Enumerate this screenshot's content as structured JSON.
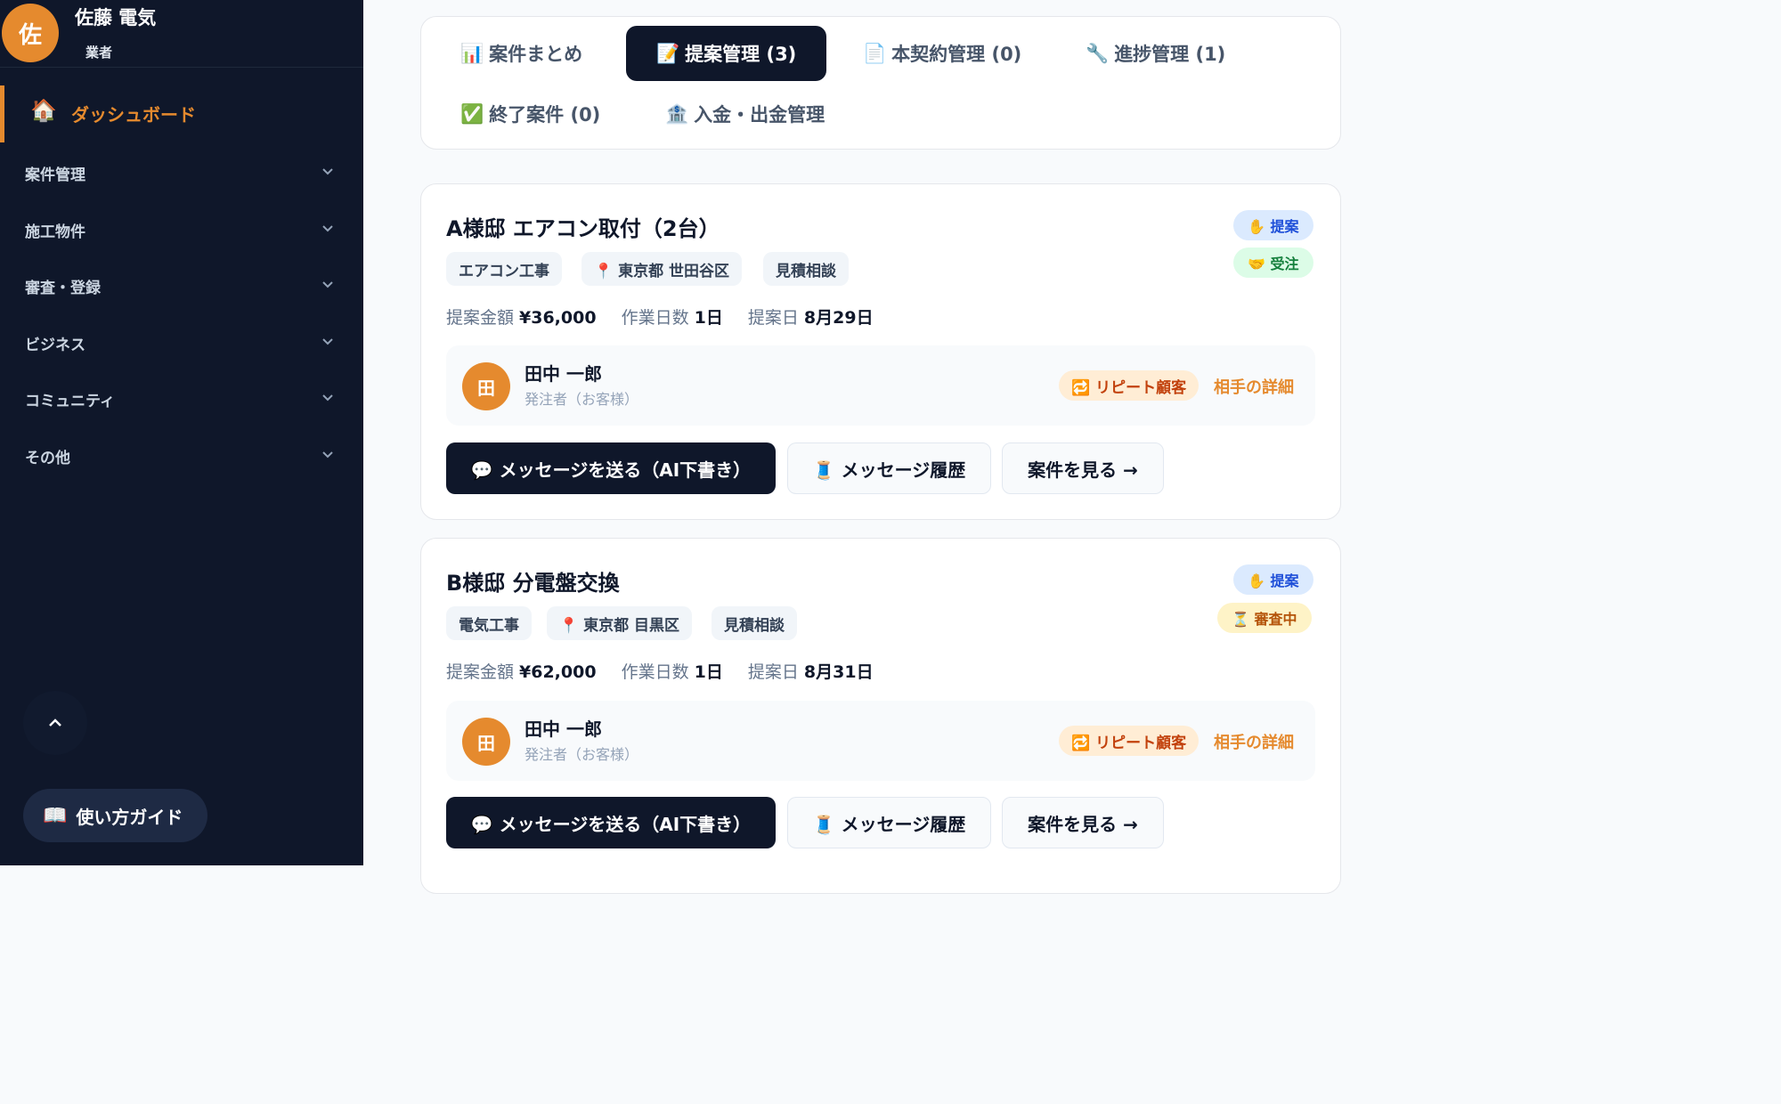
{
  "sidebar": {
    "user": {
      "avatar_initial": "佐",
      "name": "佐藤 電気",
      "role": "業者"
    },
    "active_item": {
      "icon": "🏠",
      "icon_name": "house-icon",
      "label": "ダッシュボード"
    },
    "groups": [
      {
        "label": "案件管理"
      },
      {
        "label": "施工物件"
      },
      {
        "label": "審査・登録"
      },
      {
        "label": "ビジネス"
      },
      {
        "label": "コミュニティ"
      },
      {
        "label": "その他"
      }
    ],
    "guide": {
      "icon": "📖",
      "icon_name": "book-icon",
      "label": "使い方ガイド"
    }
  },
  "tabs": [
    {
      "icon": "📊",
      "icon_name": "chart-icon",
      "label": "案件まとめ"
    },
    {
      "icon": "📝",
      "icon_name": "memo-icon",
      "label": "提案管理 (3)"
    },
    {
      "icon": "📄",
      "icon_name": "document-icon",
      "label": "本契約管理 (0)"
    },
    {
      "icon": "🔧",
      "icon_name": "wrench-icon",
      "label": "進捗管理 (1)"
    },
    {
      "icon": "✅",
      "icon_name": "check-icon",
      "label": "終了案件 (0)"
    },
    {
      "icon": "🏦",
      "icon_name": "bank-icon",
      "label": "入金・出金管理"
    }
  ],
  "cards": [
    {
      "title": "A様邸 エアコン取付（2台）",
      "status1": "✋ 提案",
      "status2": "🤝 受注",
      "chips": [
        "エアコン工事",
        "📍 東京都 世田谷区",
        "見積相談"
      ],
      "amount_label": "提案金額",
      "amount": "¥36,000",
      "days_label": "作業日数",
      "days": "1日",
      "date_label": "提案日",
      "date": "8月29日",
      "client": {
        "initial": "田",
        "name": "田中 一郎",
        "role": "発注者（お客様）",
        "badge": "🔁 リピート顧客",
        "link": "相手の詳細"
      },
      "btn_message": "💬 メッセージを送る（AI下書き）",
      "btn_history": "🧵 メッセージ履歴",
      "btn_view": "案件を見る →"
    },
    {
      "title": "B様邸 分電盤交換",
      "status1": "✋ 提案",
      "status2": "⏳ 審査中",
      "chips": [
        "電気工事",
        "📍 東京都 目黒区",
        "見積相談"
      ],
      "amount_label": "提案金額",
      "amount": "¥62,000",
      "days_label": "作業日数",
      "days": "1日",
      "date_label": "提案日",
      "date": "8月31日",
      "client": {
        "initial": "田",
        "name": "田中 一郎",
        "role": "発注者（お客様）",
        "badge": "🔁 リピート顧客",
        "link": "相手の詳細"
      },
      "btn_message": "💬 メッセージを送る（AI下書き）",
      "btn_history": "🧵 メッセージ履歴",
      "btn_view": "案件を見る →"
    }
  ]
}
